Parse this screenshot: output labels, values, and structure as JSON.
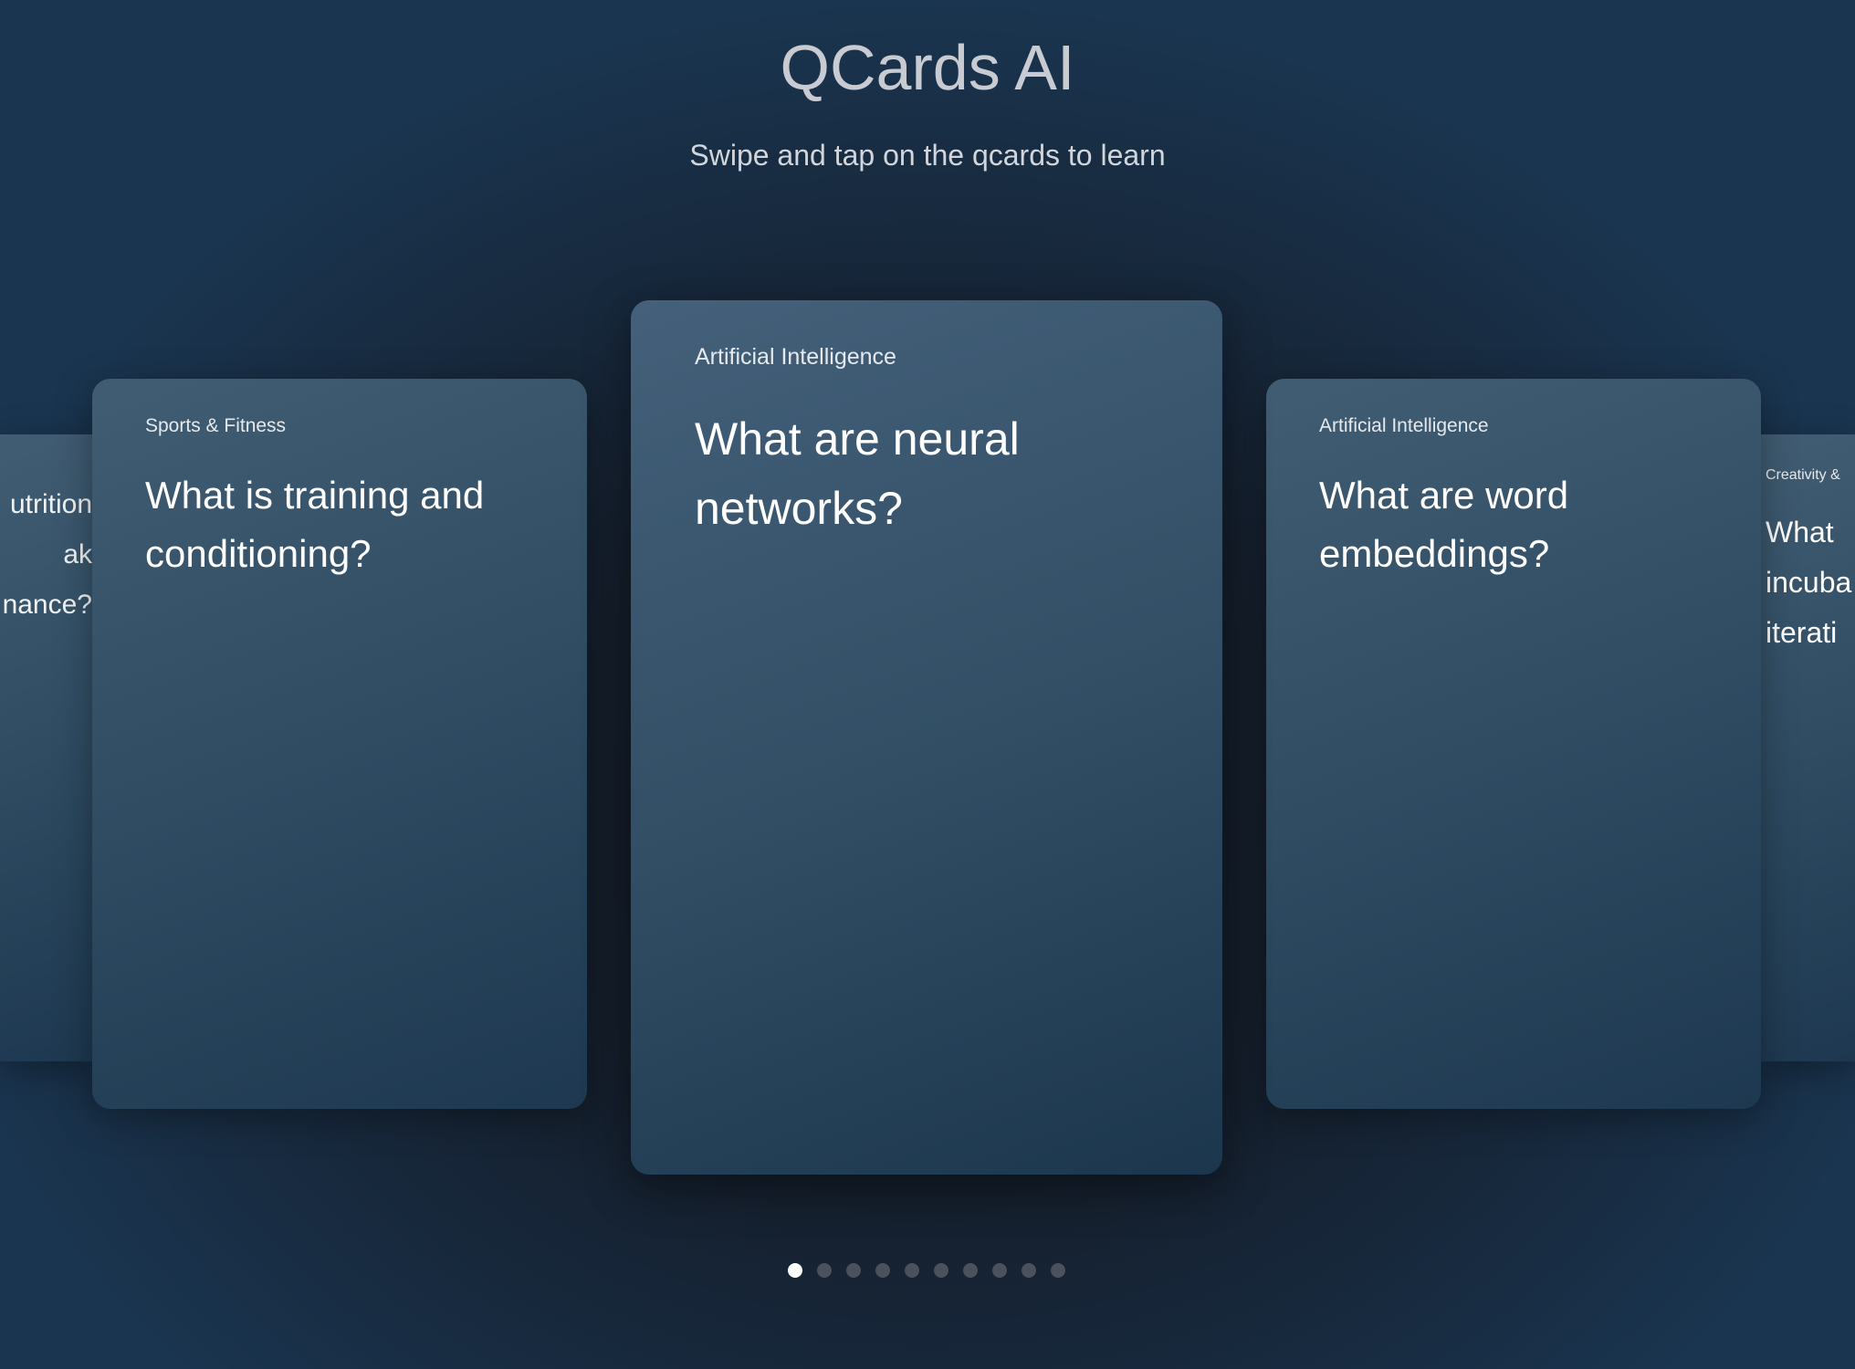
{
  "header": {
    "title": "QCards AI",
    "subtitle": "Swipe and tap on the qcards to learn"
  },
  "cards": {
    "far_left": {
      "lines": [
        "utrition",
        "ak",
        "nance?"
      ]
    },
    "left": {
      "category": "Sports & Fitness",
      "question": "What is training and conditioning?"
    },
    "center": {
      "category": "Artificial Intelligence",
      "question": "What are neural networks?"
    },
    "right": {
      "category": "Artificial Intelligence",
      "question": "What are word embeddings?"
    },
    "far_right": {
      "category": "Creativity &",
      "lines": [
        "What",
        "incuba",
        "iterati"
      ]
    }
  },
  "pagination": {
    "total": 10,
    "active_index": 0,
    "active_color": "#ffffff",
    "inactive_color": "#4c525d"
  }
}
